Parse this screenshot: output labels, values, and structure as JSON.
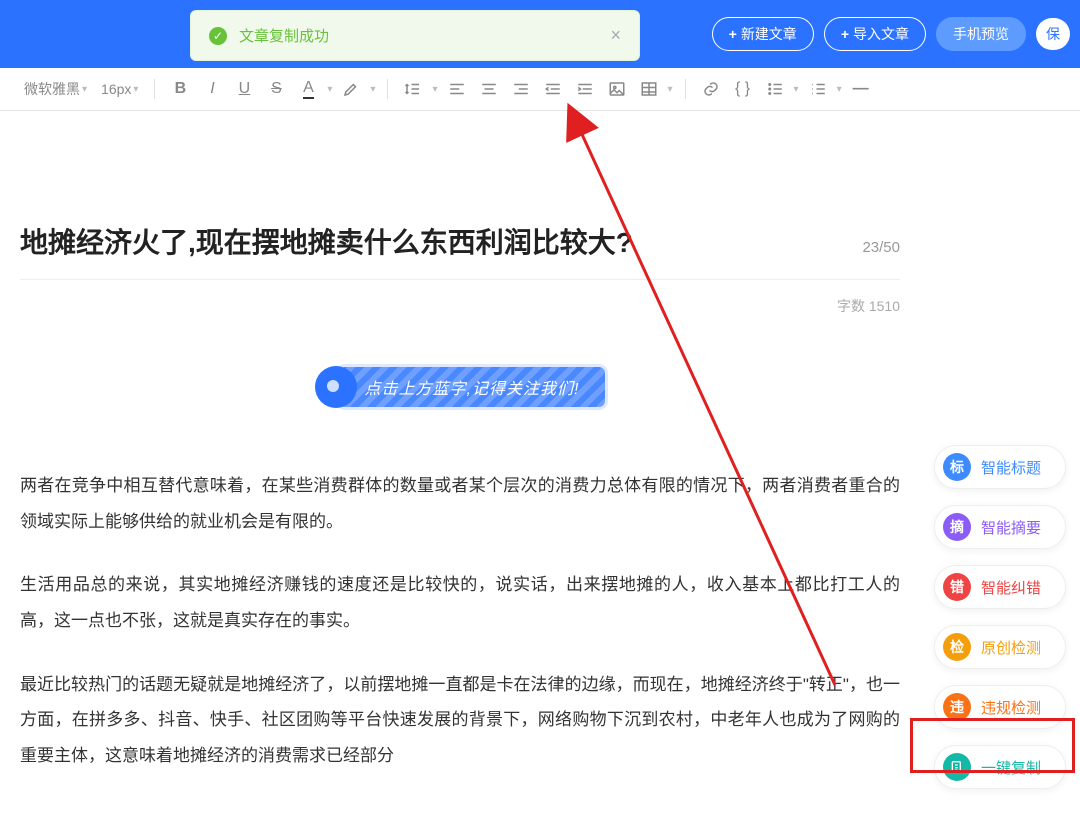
{
  "toast": {
    "message": "文章复制成功"
  },
  "header": {
    "new_article": "新建文章",
    "import_article": "导入文章",
    "phone_preview": "手机预览",
    "save": "保"
  },
  "toolbar": {
    "font_family": "微软雅黑",
    "font_size": "16px"
  },
  "article": {
    "title": "地摊经济火了,现在摆地摊卖什么东西利润比较大?",
    "title_counter": "23/50",
    "word_count_label": "字数 1510",
    "banner_text": "点击上方蓝字,记得关注我们!",
    "paragraphs": [
      "两者在竞争中相互替代意味着，在某些消费群体的数量或者某个层次的消费力总体有限的情况下，两者消费者重合的领域实际上能够供给的就业机会是有限的。",
      "生活用品总的来说，其实地摊经济赚钱的速度还是比较快的，说实话，出来摆地摊的人，收入基本上都比打工人的高，这一点也不张，这就是真实存在的事实。",
      "最近比较热门的话题无疑就是地摊经济了，以前摆地摊一直都是卡在法律的边缘，而现在，地摊经济终于\"转正\"，也一方面，在拼多多、抖音、快手、社区团购等平台快速发展的背景下，网络购物下沉到农村，中老年人也成为了网购的重要主体，这意味着地摊经济的消费需求已经部分"
    ]
  },
  "side": {
    "smart_title": {
      "badge": "标",
      "label": "智能标题"
    },
    "smart_summary": {
      "badge": "摘",
      "label": "智能摘要"
    },
    "smart_correct": {
      "badge": "错",
      "label": "智能纠错"
    },
    "original_check": {
      "badge": "检",
      "label": "原创检测"
    },
    "violation_check": {
      "badge": "违",
      "label": "违规检测"
    },
    "one_click_copy": {
      "badge": "",
      "label": "一键复制"
    }
  }
}
